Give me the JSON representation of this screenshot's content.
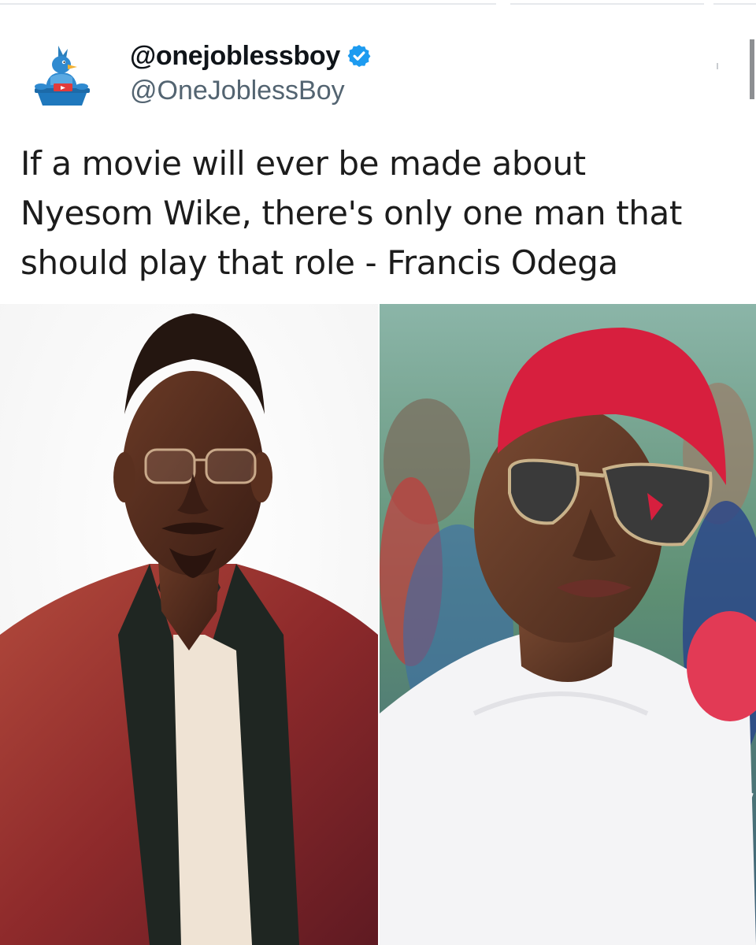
{
  "tweet": {
    "display_name": "@onejoblessboy",
    "handle": "@OneJoblessBoy",
    "verified": true,
    "text_lines": [
      "If a movie will ever be made about",
      "Nyesom Wike, there's only one man that",
      "should play that role - Francis Odega"
    ]
  },
  "icons": {
    "verified": "verified-badge-icon",
    "avatar": "avatar-illustration"
  },
  "colors": {
    "verified_blue": "#1d9bf0",
    "handle_gray": "#536471",
    "text": "#1c1c1c"
  }
}
